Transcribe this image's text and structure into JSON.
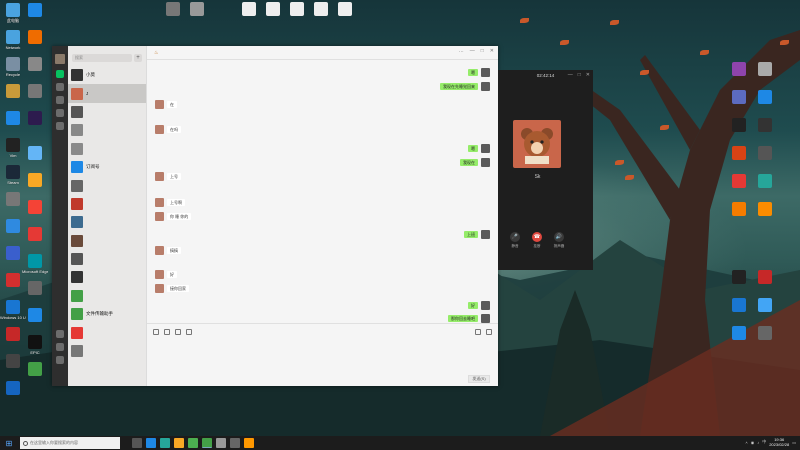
{
  "colors": {
    "wechat_green": "#95ec69",
    "wechat_sidebar": "#2e2e2e",
    "call_bg": "#1e1e1e",
    "hangup_red": "#e0483f"
  },
  "desktop": {
    "left_icons": [
      {
        "label": "此电脑",
        "icon": "computer-icon",
        "color": "#4aa3df"
      },
      {
        "label": "Network",
        "icon": "network-icon",
        "color": "#4aa3df"
      },
      {
        "label": "Recycle",
        "icon": "recycle-bin-icon",
        "color": "#7a8fa3"
      },
      {
        "label": "",
        "icon": "app-icon",
        "color": "#c89a3a"
      },
      {
        "label": "",
        "icon": "edge-icon",
        "color": "#1e88e5"
      },
      {
        "label": "Vim",
        "icon": "vim-icon",
        "color": "#222"
      },
      {
        "label": "Steam",
        "icon": "steam-icon",
        "color": "#1b2838"
      },
      {
        "label": "",
        "icon": "app-icon",
        "color": "#777"
      },
      {
        "label": "",
        "icon": "app-icon",
        "color": "#2f8ae0"
      },
      {
        "label": "",
        "icon": "app-icon",
        "color": "#3a5fcd"
      },
      {
        "label": "",
        "icon": "app-icon",
        "color": "#d32f2f"
      },
      {
        "label": "Windows 10 Update",
        "icon": "windows-icon",
        "color": "#1976d2"
      },
      {
        "label": "",
        "icon": "app-icon",
        "color": "#c62828"
      },
      {
        "label": "",
        "icon": "app-icon",
        "color": "#444"
      },
      {
        "label": "",
        "icon": "app-icon",
        "color": "#1565c0"
      }
    ],
    "second_col_icons": [
      {
        "label": "",
        "icon": "app-icon",
        "color": "#1e88e5"
      },
      {
        "label": "",
        "icon": "app-icon",
        "color": "#ef6c00"
      },
      {
        "label": "",
        "icon": "app-icon",
        "color": "#888"
      },
      {
        "label": "",
        "icon": "app-icon",
        "color": "#777"
      },
      {
        "label": "",
        "icon": "premiere-icon",
        "color": "#2d1b4e"
      },
      {
        "label": "",
        "icon": "app-icon",
        "color": "#64b5f6"
      },
      {
        "label": "",
        "icon": "app-icon",
        "color": "#f9a825"
      },
      {
        "label": "",
        "icon": "app-icon",
        "color": "#f44336"
      },
      {
        "label": "",
        "icon": "app-icon",
        "color": "#e53935"
      },
      {
        "label": "Microsoft Edge",
        "icon": "edge-icon",
        "color": "#0097a7"
      },
      {
        "label": "",
        "icon": "app-icon",
        "color": "#666"
      },
      {
        "label": "",
        "icon": "app-icon",
        "color": "#1e88e5"
      },
      {
        "label": "EPIC",
        "icon": "epic-icon",
        "color": "#111"
      },
      {
        "label": "",
        "icon": "wechat-icon",
        "color": "#43a047"
      }
    ],
    "top_icons": [
      {
        "label": "",
        "color": "#777"
      },
      {
        "label": "",
        "color": "#999"
      },
      {
        "label": "",
        "color": "#eee"
      },
      {
        "label": "",
        "color": "#eee"
      },
      {
        "label": "",
        "color": "#eee"
      },
      {
        "label": "",
        "color": "#eee"
      },
      {
        "label": "",
        "color": "#eee"
      }
    ],
    "right_icons": [
      {
        "label": "",
        "color": "#8e44ad"
      },
      {
        "label": "",
        "color": "#aaa"
      },
      {
        "label": "",
        "color": "#5c6bc0"
      },
      {
        "label": "",
        "color": "#1e88e5"
      },
      {
        "label": "",
        "color": "#222"
      },
      {
        "label": "",
        "color": "#333"
      },
      {
        "label": "",
        "color": "#d84315"
      },
      {
        "label": "",
        "color": "#555"
      },
      {
        "label": "",
        "color": "#e53935"
      },
      {
        "label": "",
        "color": "#26a69a"
      },
      {
        "label": "",
        "color": "#f57c00"
      },
      {
        "label": "",
        "color": "#fb8c00"
      },
      {
        "label": "",
        "color": "#222"
      },
      {
        "label": "",
        "color": "#c62828"
      },
      {
        "label": "",
        "color": "#1976d2"
      },
      {
        "label": "",
        "color": "#42a5f5"
      },
      {
        "label": "",
        "color": "#1e88e5"
      },
      {
        "label": "",
        "color": "#666"
      }
    ]
  },
  "wechat": {
    "search_placeholder": "搜索",
    "plus_label": "+",
    "chats": [
      {
        "name": "小莫",
        "preview": "",
        "color": "#333"
      },
      {
        "name": "J",
        "preview": "",
        "color": "#c9664a",
        "active": true
      },
      {
        "name": "",
        "preview": "",
        "color": "#555"
      },
      {
        "name": "",
        "preview": "",
        "color": "#888"
      },
      {
        "name": "",
        "preview": "",
        "color": "#8a8a8a"
      },
      {
        "name": "订阅号",
        "preview": "",
        "color": "#1e88e5"
      },
      {
        "name": "",
        "preview": "",
        "color": "#666"
      },
      {
        "name": "",
        "preview": "",
        "color": "#c0392b"
      },
      {
        "name": "",
        "preview": "",
        "color": "#3d6b8f"
      },
      {
        "name": "",
        "preview": "",
        "color": "#6a4a3a"
      },
      {
        "name": "",
        "preview": "",
        "color": "#555"
      },
      {
        "name": "",
        "preview": "",
        "color": "#333"
      },
      {
        "name": "",
        "preview": "",
        "color": "#43a047"
      },
      {
        "name": "文件传输助手",
        "preview": "",
        "color": "#43a047"
      },
      {
        "name": "",
        "preview": "",
        "color": "#e53935"
      },
      {
        "name": "",
        "preview": "",
        "color": "#777"
      }
    ],
    "header_title": "♨",
    "header_controls": [
      "…",
      "—",
      "□",
      "✕"
    ],
    "messages": [
      {
        "dir": "out",
        "text": "嗯"
      },
      {
        "dir": "out",
        "text": "我现在先睡觉回来"
      },
      {
        "dir": "in",
        "text": "在"
      },
      {
        "dir": "in",
        "text": "在吗"
      },
      {
        "dir": "out",
        "text": "嗯"
      },
      {
        "dir": "out",
        "text": "我现在"
      },
      {
        "dir": "in",
        "text": "上号"
      },
      {
        "dir": "in",
        "text": "上号啊"
      },
      {
        "dir": "in",
        "text": "你 睡 你的"
      },
      {
        "dir": "out",
        "text": "上班"
      },
      {
        "dir": "in",
        "text": "搞搞"
      },
      {
        "dir": "in",
        "text": "好"
      },
      {
        "dir": "in",
        "text": "接你回家"
      },
      {
        "dir": "out",
        "text": "好"
      },
      {
        "dir": "out",
        "text": "那你回去睡吧"
      }
    ],
    "send_label": "发送(S)"
  },
  "call": {
    "timer": "02:42:14",
    "controls": [
      "—",
      "□",
      "✕"
    ],
    "name": "Sk",
    "buttons": [
      {
        "label": "静音",
        "icon": "mic-icon"
      },
      {
        "label": "挂断",
        "icon": "hangup-icon"
      },
      {
        "label": "扬声器",
        "icon": "speaker-icon"
      }
    ]
  },
  "taskbar": {
    "search_placeholder": "在这里输入你要搜索的内容",
    "apps": [
      {
        "icon": "task-view-icon",
        "color": "#555"
      },
      {
        "icon": "edge-icon",
        "color": "#1e88e5"
      },
      {
        "icon": "app-icon",
        "color": "#26a69a"
      },
      {
        "icon": "explorer-icon",
        "color": "#f9a825"
      },
      {
        "icon": "chrome-icon",
        "color": "#4caf50"
      },
      {
        "icon": "wechat-icon",
        "color": "#43a047",
        "active": true
      },
      {
        "icon": "app-icon",
        "color": "#999"
      },
      {
        "icon": "app-icon",
        "color": "#666"
      },
      {
        "icon": "app-icon",
        "color": "#ff9800"
      }
    ],
    "time": "19:36",
    "date": "2023/02/28"
  }
}
